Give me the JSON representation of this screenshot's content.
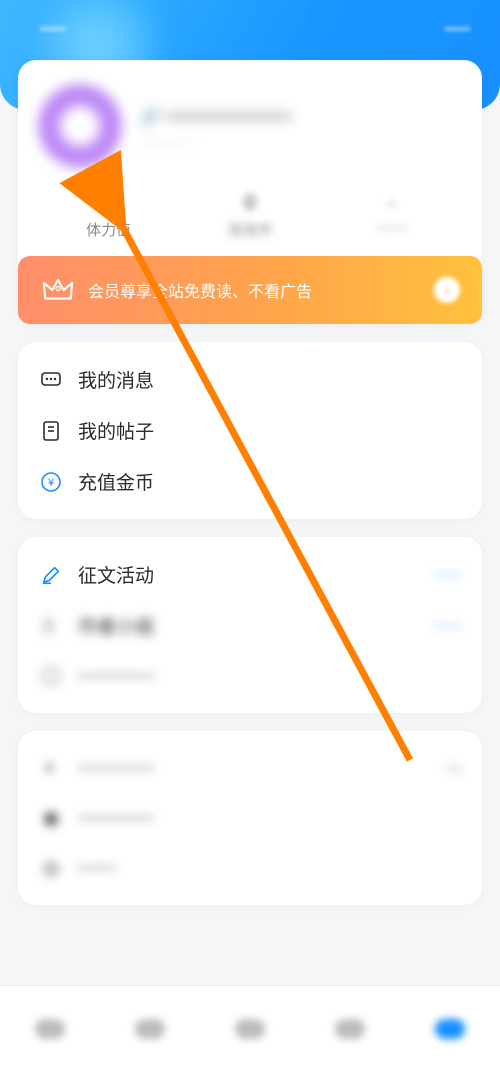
{
  "status": {
    "left": "••••••",
    "right": "••••••"
  },
  "profile": {
    "username_blur": "——————",
    "subline_blur": "————",
    "marker_icon": "link-icon"
  },
  "stats": [
    {
      "value": "0",
      "label": "体力值",
      "blur": false
    },
    {
      "value": "0",
      "label": "泡泡币",
      "blur": true
    },
    {
      "value": "-",
      "label": "——",
      "blur": true
    }
  ],
  "vip_banner": {
    "text": "会员尊享全站免费读、不看广告",
    "crown_icon": "crown-icon",
    "trailing_icon": "arrow-icon"
  },
  "menu_group1": [
    {
      "icon": "message-icon",
      "label": "我的消息",
      "has_dot": true,
      "blur": false
    },
    {
      "icon": "post-icon",
      "label": "我的帖子",
      "has_dot": false,
      "blur": false
    },
    {
      "icon": "coin-icon",
      "label": "充值金币",
      "has_dot": false,
      "blur": false
    }
  ],
  "menu_group2": [
    {
      "icon": "pencil-icon",
      "label": "征文活动",
      "right_text": "——",
      "right_color": "#3b9bff",
      "blur": false
    },
    {
      "icon": "author-icon",
      "label": "作者小组",
      "right_text": "——",
      "right_color": "#3b9bff",
      "blur": true
    },
    {
      "icon": "misc-icon",
      "label": "————",
      "right_text": "",
      "right_color": "",
      "blur": true
    }
  ],
  "menu_group3": [
    {
      "icon": "mode-icon",
      "label": "————",
      "right_text": "—",
      "blur": true
    },
    {
      "icon": "net-icon",
      "label": "————",
      "right_text": "",
      "blur": true
    },
    {
      "icon": "set-icon",
      "label": "——",
      "right_text": "",
      "blur": true
    }
  ],
  "nav": {
    "items": [
      "home",
      "shelf",
      "center",
      "write",
      "me"
    ],
    "active_index": 4
  },
  "annotation": {
    "type": "arrow",
    "color": "#ff8000"
  }
}
